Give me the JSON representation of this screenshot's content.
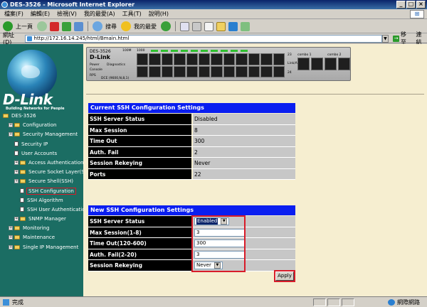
{
  "window": {
    "title": "DES-3526 - Microsoft Internet Explorer",
    "controls": [
      "_",
      "□",
      "×"
    ]
  },
  "menu": [
    "檔案(F)",
    "編輯(E)",
    "檢視(V)",
    "我的最愛(A)",
    "工具(T)",
    "說明(H)"
  ],
  "toolbar": {
    "back_label": "上一頁",
    "search_label": "搜尋",
    "favorites_label": "我的最愛"
  },
  "address": {
    "label": "網址(D)",
    "url": "http://172.16.14.245/html/Bmain.html",
    "go_label": "移至",
    "links_label": "連結"
  },
  "sidebar": {
    "brand": "D-Link",
    "tagline": "Building Networks for People",
    "items": [
      {
        "label": "DES-3526",
        "indent": 0,
        "icon": "folder",
        "expander": false
      },
      {
        "label": "Configuration",
        "indent": 1,
        "icon": "folder",
        "expander": true
      },
      {
        "label": "Security Management",
        "indent": 1,
        "icon": "folder",
        "expander": true
      },
      {
        "label": "Security IP",
        "indent": 2,
        "icon": "doc",
        "expander": false
      },
      {
        "label": "User Accounts",
        "indent": 2,
        "icon": "doc",
        "expander": false
      },
      {
        "label": "Access Authentication Con",
        "indent": 2,
        "icon": "folder",
        "expander": true
      },
      {
        "label": "Secure Socket Layer(SSL)",
        "indent": 2,
        "icon": "folder",
        "expander": true
      },
      {
        "label": "Secure Shell(SSH)",
        "indent": 2,
        "icon": "folder",
        "expander": true
      },
      {
        "label": "SSH Configuration",
        "indent": 3,
        "icon": "doc",
        "expander": false,
        "selected": true
      },
      {
        "label": "SSH Algorithm",
        "indent": 3,
        "icon": "doc",
        "expander": false
      },
      {
        "label": "SSH User Authentication",
        "indent": 3,
        "icon": "doc",
        "expander": false
      },
      {
        "label": "SNMP Manager",
        "indent": 2,
        "icon": "folder",
        "expander": true
      },
      {
        "label": "Monitoring",
        "indent": 1,
        "icon": "folder",
        "expander": true
      },
      {
        "label": "Maintenance",
        "indent": 1,
        "icon": "folder",
        "expander": true
      },
      {
        "label": "Single IP Management",
        "indent": 1,
        "icon": "folder",
        "expander": true
      }
    ]
  },
  "device": {
    "model": "DES-3526",
    "brand": "D-Link",
    "labels": {
      "power": "Power",
      "console": "Console",
      "rps": "RPS",
      "diagnostics": "Diagnostics",
      "speed": "100M",
      "link_mode": "1000",
      "combo1": "combo 1",
      "combo2": "combo 2",
      "port23": "23",
      "port24": "24",
      "link_act": "Link/Act",
      "duplex": "DCE (9600,N,8,1)"
    }
  },
  "current": {
    "title": "Current SSH Configuration Settings",
    "rows": [
      {
        "key": "SSH Server Status",
        "value": "Disabled"
      },
      {
        "key": "Max Session",
        "value": "8"
      },
      {
        "key": "Time Out",
        "value": "300"
      },
      {
        "key": "Auth. Fail",
        "value": "2"
      },
      {
        "key": "Session Rekeying",
        "value": "Never"
      },
      {
        "key": "Ports",
        "value": "22"
      }
    ]
  },
  "new": {
    "title": "New SSH Configuration Settings",
    "server_status_label": "SSH Server Status",
    "server_status_value": "Enabled",
    "max_session_label": "Max Session(1-8)",
    "max_session_value": "3",
    "timeout_label": "Time Out(120-600)",
    "timeout_value": "300",
    "auth_fail_label": "Auth. Fail(2-20)",
    "auth_fail_value": "3",
    "rekey_label": "Session Rekeying",
    "rekey_value": "Never",
    "apply_label": "Apply"
  },
  "status": {
    "done": "完成",
    "zone": "網際網路"
  },
  "colors": {
    "sidebar_bg": "#1b6d63",
    "content_bg": "#f6eed0",
    "header_blue": "#0a1ef0",
    "highlight_red": "#d81c2a"
  }
}
